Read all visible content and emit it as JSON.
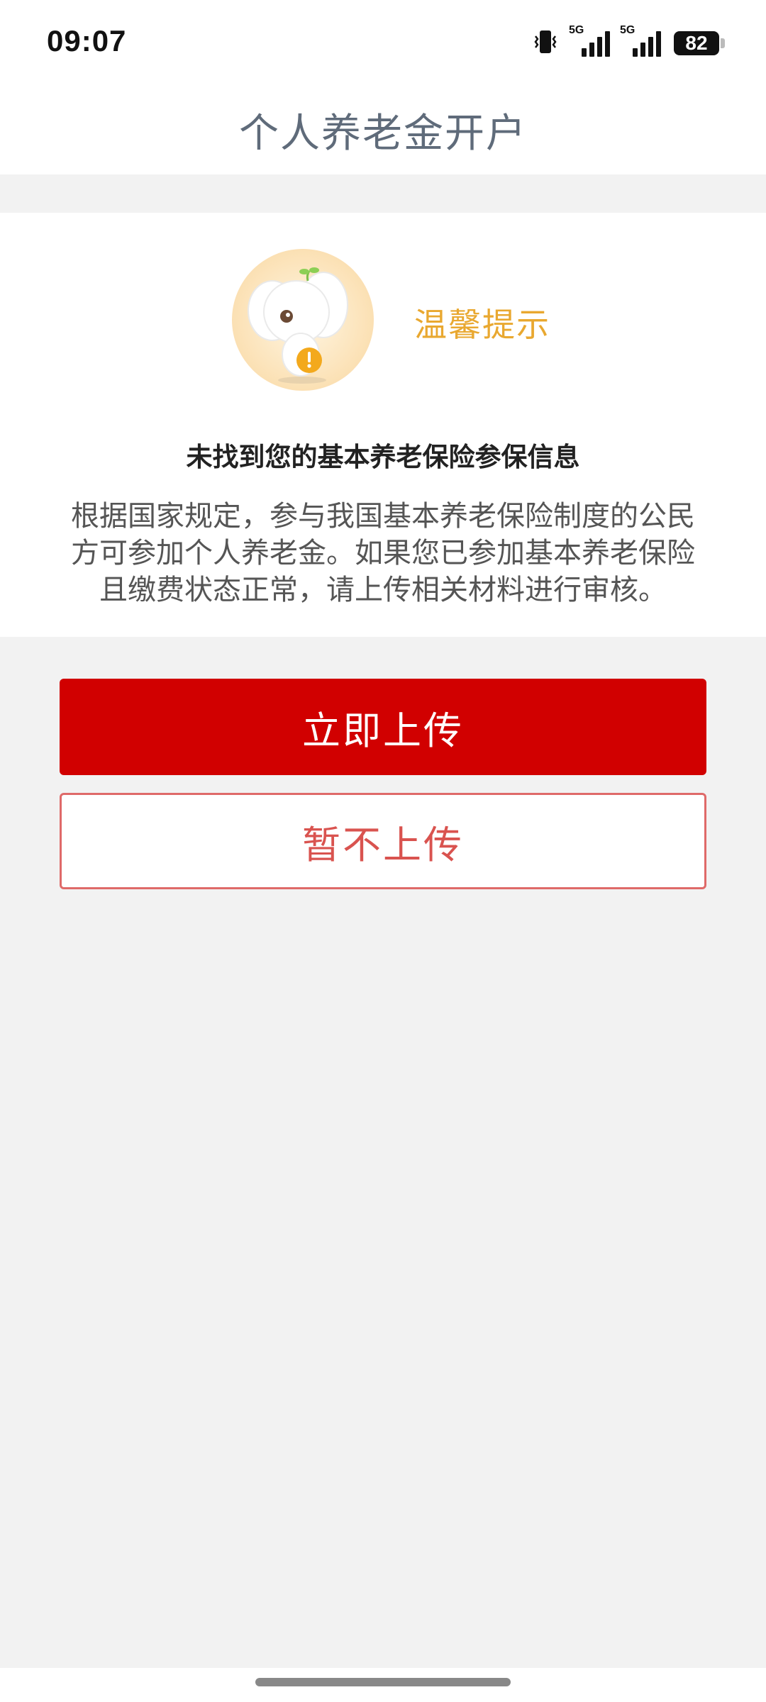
{
  "status_bar": {
    "time": "09:07",
    "network_label_1": "5G",
    "network_label_2": "5G",
    "battery_level": "82"
  },
  "header": {
    "title": "个人养老金开户"
  },
  "notice": {
    "tip_title": "温馨提示",
    "heading": "未找到您的基本养老保险参保信息",
    "body": "根据国家规定，参与我国基本养老保险制度的公民方可参加个人养老金。如果您已参加基本养老保险且缴费状态正常，请上传相关材料进行审核。"
  },
  "actions": {
    "upload_now": "立即上传",
    "skip_upload": "暂不上传"
  },
  "colors": {
    "primary": "#d10000",
    "secondary_border": "#df6a69",
    "tip_title": "#e9a830",
    "background": "#f2f2f2"
  },
  "icons": [
    "vibrate-icon",
    "signal-icon",
    "battery-icon",
    "mascot-elephant-icon",
    "warning-icon"
  ]
}
